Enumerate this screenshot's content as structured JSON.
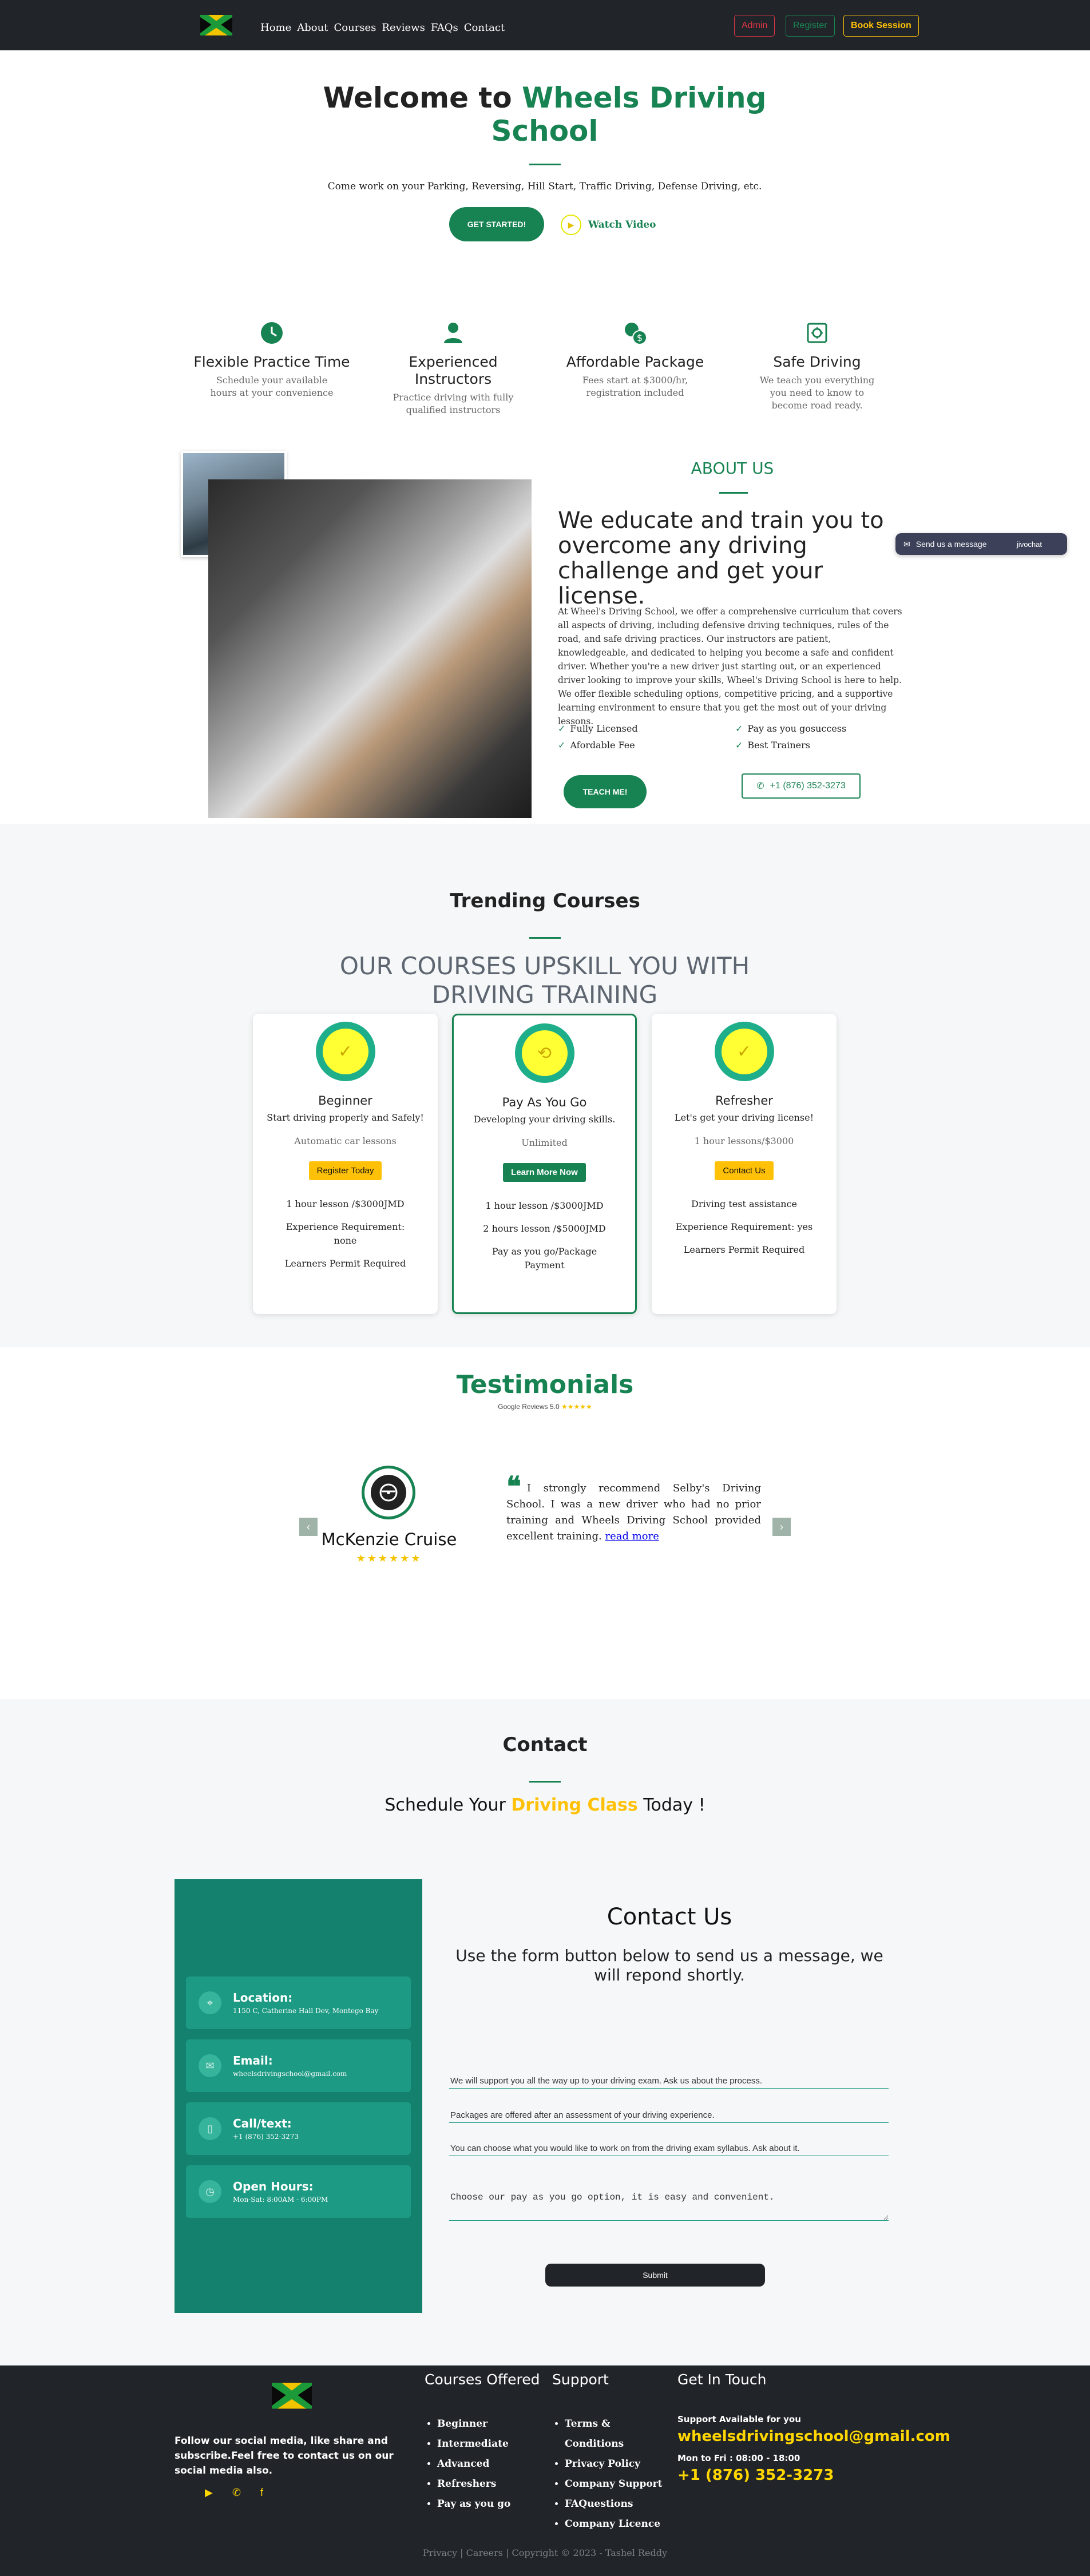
{
  "nav": {
    "links": [
      "Home",
      "About",
      "Courses",
      "Reviews",
      "FAQs",
      "Contact"
    ],
    "admin": "Admin",
    "register": "Register",
    "book": "Book Session"
  },
  "hero": {
    "title_pre": "Welcome to ",
    "title_brand": "Wheels Driving School",
    "subtitle": "Come work on your Parking, Reversing, Hill Start, Traffic Driving, Defense Driving, etc.",
    "cta": "GET STARTED!",
    "watch": "Watch Video"
  },
  "features": [
    {
      "icon": "clock-icon",
      "title": "Flexible Practice Time",
      "desc": "Schedule your available hours at your convenience"
    },
    {
      "icon": "user-icon",
      "title": "Experienced Instructors",
      "desc": "Practice driving with fully qualified instructors"
    },
    {
      "icon": "coins-icon",
      "title": "Affordable Package",
      "desc": "Fees start at $3000/hr, registration included"
    },
    {
      "icon": "safe-icon",
      "title": "Safe Driving",
      "desc": "We teach you everything you need to know to become road ready."
    }
  ],
  "about": {
    "heading": "ABOUT US",
    "title": "We educate and train you to overcome any driving challenge and get your license.",
    "text": "At Wheel's Driving School, we offer a comprehensive curriculum that covers all aspects of driving, including defensive driving techniques, rules of the road, and safe driving practices. Our instructors are patient, knowledgeable, and dedicated to helping you become a safe and confident driver. Whether you're a new driver just starting out, or an experienced driver looking to improve your skills, Wheel's Driving School is here to help. We offer flexible scheduling options, competitive pricing, and a supportive learning environment to ensure that you get the most out of your driving lessons.",
    "checks": [
      "Fully Licensed",
      "Pay as you gosuccess",
      "Afordable Fee",
      "Best Trainers"
    ],
    "cta": "TEACH ME!",
    "phone": "+1 (876) 352-3273"
  },
  "chat": {
    "label": "Send us a message",
    "brand": "jivochat"
  },
  "courses": {
    "heading": "Trending Courses",
    "subheading": "OUR COURSES UPSKILL YOU WITH DRIVING TRAINING",
    "cards": [
      {
        "name": "Beginner",
        "tagline": "Start driving properly and Safely!",
        "lessons": "Automatic car lessons",
        "button": "Register Today",
        "features": [
          "1 hour lesson /$3000JMD",
          "Experience Requirement: none",
          "Learners Permit Required"
        ]
      },
      {
        "name": "Pay As You Go",
        "tagline": "Developing your driving skills.",
        "lessons": "Unlimited",
        "button": "Learn More Now",
        "features": [
          "1 hour lesson /$3000JMD",
          "2 hours lesson /$5000JMD",
          "Pay as you go/Package Payment"
        ]
      },
      {
        "name": "Refresher",
        "tagline": "Let's get your driving license!",
        "lessons": "1 hour lessons/$3000",
        "button": "Contact Us",
        "features": [
          "Driving test assistance",
          "Experience Requirement: yes",
          "Learners Permit Required"
        ]
      }
    ]
  },
  "testimonials": {
    "heading": "Testimonials",
    "sub": "Google Reviews 5.0",
    "sub_stars": "★★★★★",
    "name": "McKenzie Cruise",
    "stars": "★★★★★★",
    "quote": "I strongly recommend Selby's Driving School. I was a new driver who had no prior training and Wheels Driving School provided excellent training.",
    "read_more": "read more",
    "prev": "‹",
    "next": "›"
  },
  "contact": {
    "heading": "Contact",
    "sched_pre": "Schedule Your ",
    "sched_hl": "Driving Class",
    "sched_post": " Today !",
    "info": [
      {
        "icon": "location-icon",
        "title": "Location:",
        "value": "1150 C, Catherine Hall Dev, Montego Bay"
      },
      {
        "icon": "email-icon",
        "title": "Email:",
        "value": "wheelsdrivingschool@gmail.com"
      },
      {
        "icon": "phone-icon",
        "title": "Call/text:",
        "value": "+1 (876) 352-3273"
      },
      {
        "icon": "clock-icon",
        "title": "Open Hours:",
        "value": "Mon-Sat: 8:00AM - 6:00PM"
      }
    ],
    "form_title": "Contact Us",
    "form_sub": "Use the form button below to send us a message, we will repond shortly.",
    "fields": [
      "We will support you all the way up to your driving exam. Ask us about the process.",
      "Packages are offered after an assessment of your driving experience.",
      "You can choose what you would like to work on from the driving exam syllabus. Ask about it."
    ],
    "textarea": "Choose our pay as you go option, it is easy and convenient.",
    "submit": "Submit"
  },
  "footer": {
    "text": "Follow our social media, like share and subscribe.Feel free to contact us on our social media also.",
    "courses_title": "Courses Offered",
    "courses": [
      "Beginner",
      "Intermediate",
      "Advanced",
      "Refreshers",
      "Pay as you go"
    ],
    "support_title": "Support",
    "support": [
      "Terms & Conditions",
      "Privacy Policy",
      "Company Support",
      "FAQuestions",
      "Company Licence"
    ],
    "touch_title": "Get In Touch",
    "support_label": "Support Available for you",
    "email": "wheelsdrivingschool@gmail.com",
    "hours_label": "Mon to Fri : 08:00 - 18:00",
    "phone": "+1 (876) 352-3273",
    "copyright": "Privacy | Careers | Copyright © 2023 - Tashel Reddy"
  }
}
